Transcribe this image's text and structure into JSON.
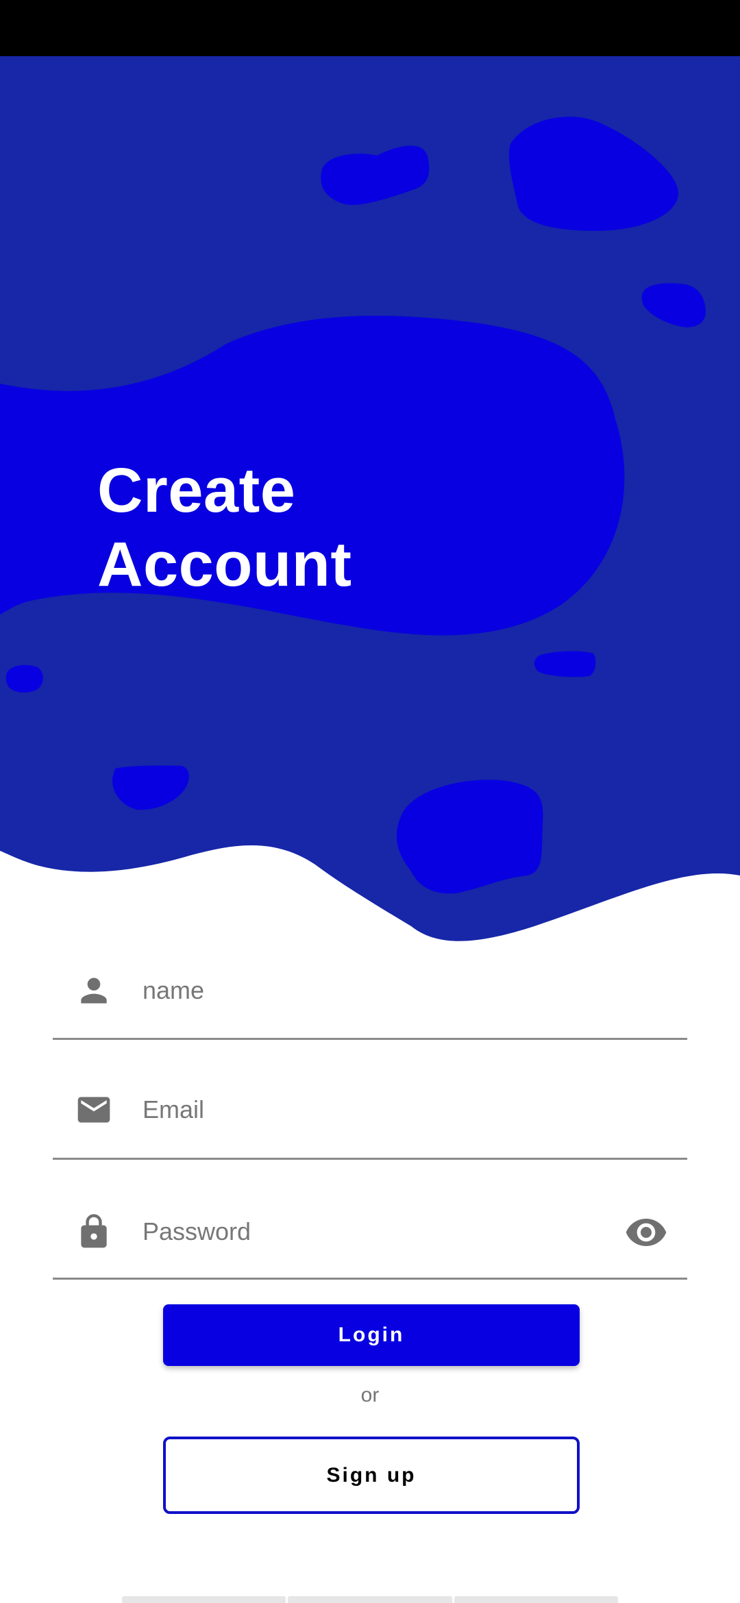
{
  "header": {
    "title_line1": "Create",
    "title_line2": "Account"
  },
  "form": {
    "name": {
      "placeholder": "name",
      "value": "",
      "icon": "person-icon"
    },
    "email": {
      "placeholder": "Email",
      "value": "",
      "icon": "mail-icon"
    },
    "password": {
      "placeholder": "Password",
      "value": "",
      "icon": "lock-icon",
      "toggle_icon": "eye-icon"
    }
  },
  "actions": {
    "login_label": "Login",
    "or_label": "or",
    "signup_label": "Sign up"
  },
  "colors": {
    "hero_background": "#1727a8",
    "hero_blob": "#0800e0",
    "primary": "#0800e0",
    "outline": "#1010c8",
    "icon_gray": "#707070"
  }
}
